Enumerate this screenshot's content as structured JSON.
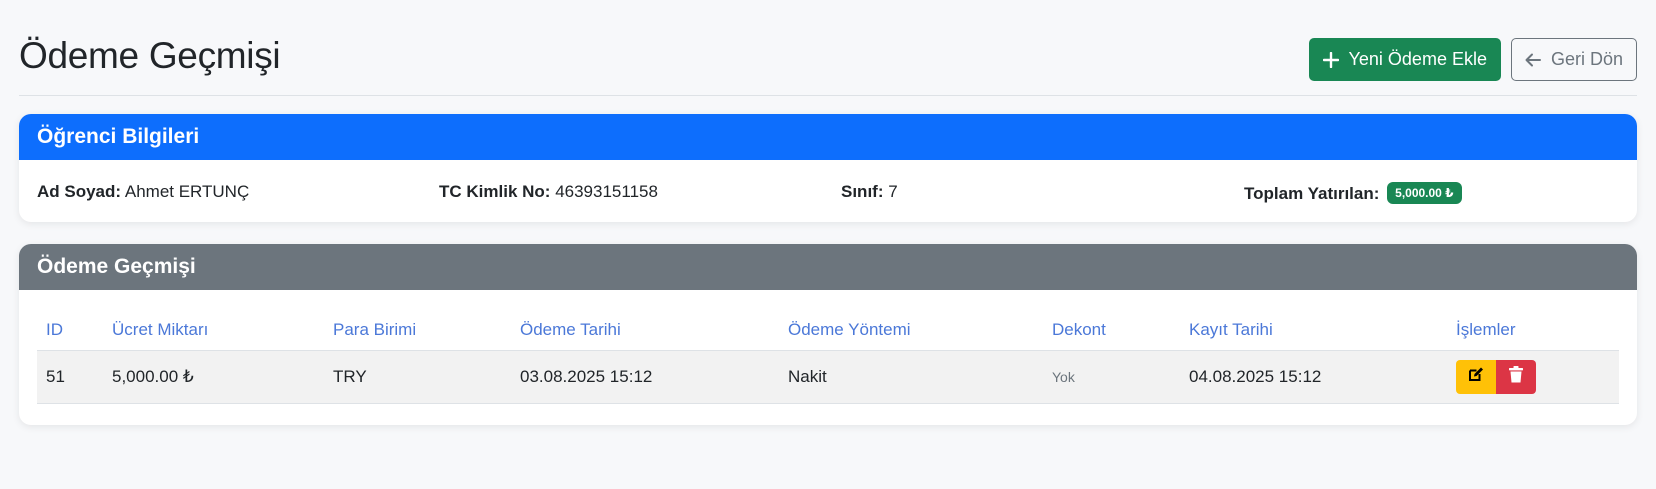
{
  "header": {
    "title": "Ödeme Geçmişi",
    "add_button": "Yeni Ödeme Ekle",
    "back_button": "Geri Dön"
  },
  "student": {
    "card_title": "Öğrenci Bilgileri",
    "name_label": "Ad Soyad:",
    "name_value": "Ahmet ERTUNÇ",
    "tc_label": "TC Kimlik No:",
    "tc_value": "46393151158",
    "class_label": "Sınıf:",
    "class_value": "7",
    "total_label": "Toplam Yatırılan:",
    "total_value": "5,000.00 ₺"
  },
  "history": {
    "card_title": "Ödeme Geçmişi",
    "columns": [
      "ID",
      "Ücret Miktarı",
      "Para Birimi",
      "Ödeme Tarihi",
      "Ödeme Yöntemi",
      "Dekont",
      "Kayıt Tarihi",
      "İşlemler"
    ],
    "rows": [
      {
        "id": "51",
        "amount": "5,000.00 ₺",
        "currency": "TRY",
        "payment_date": "03.08.2025 15:12",
        "method": "Nakit",
        "receipt": "Yok",
        "record_date": "04.08.2025 15:12"
      }
    ]
  },
  "icons": {
    "add": "plus-icon",
    "back": "arrow-left-icon",
    "edit": "edit-icon",
    "delete": "trash-icon"
  },
  "colors": {
    "primary": "#0d6efd",
    "secondary": "#6c757d",
    "success": "#198754",
    "warning": "#ffc107",
    "danger": "#dc3545",
    "table_header_text": "#4b78d8"
  }
}
